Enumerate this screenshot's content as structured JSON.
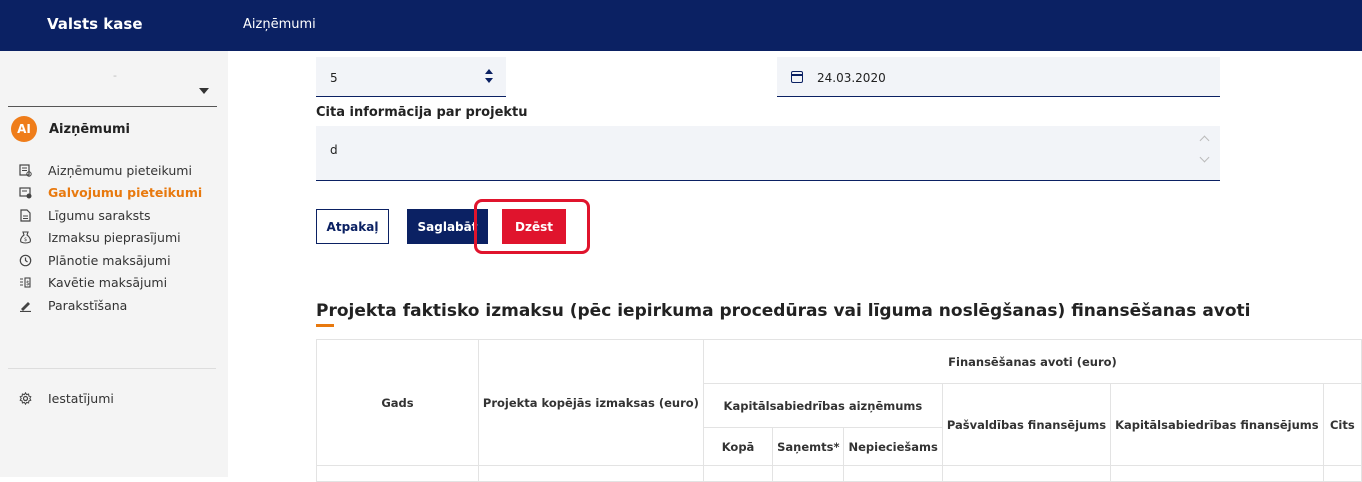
{
  "header": {
    "brand": "Valsts kase",
    "breadcrumb": "Aizņēmumi"
  },
  "sidebar": {
    "select_value": "-",
    "module": {
      "avatar": "AI",
      "title": "Aizņēmumi"
    },
    "items": [
      {
        "label": "Aizņēmumu pieteikumi",
        "icon": "application-icon"
      },
      {
        "label": "Galvojumu pieteikumi",
        "icon": "guarantee-icon",
        "active": true
      },
      {
        "label": "Līgumu saraksts",
        "icon": "document-icon"
      },
      {
        "label": "Izmaksu pieprasījumi",
        "icon": "money-bag-icon"
      },
      {
        "label": "Plānotie maksājumi",
        "icon": "clock-icon"
      },
      {
        "label": "Kavētie maksājumi",
        "icon": "overdue-icon"
      },
      {
        "label": "Parakstīšana",
        "icon": "sign-icon"
      }
    ],
    "settings": {
      "label": "Iestatījumi",
      "icon": "gear-icon"
    }
  },
  "form": {
    "number_value": "5",
    "date_value": "24.03.2020",
    "other_info_label": "Cita informācija par projektu",
    "other_info_value": "d"
  },
  "buttons": {
    "back": "Atpakaļ",
    "save": "Saglabāt",
    "delete": "Dzēst"
  },
  "section": {
    "title": "Projekta faktisko izmaksu (pēc iepirkuma procedūras vai līguma noslēgšanas) finansēšanas avoti"
  },
  "table": {
    "col_year": "Gads",
    "col_total_cost": "Projekta kopējās izmaksas (euro)",
    "group_sources": "Finansēšanas avoti (euro)",
    "group_loan": "Kapitālsabiedrības aizņēmums",
    "col_loan_total": "Kopā",
    "col_loan_received": "Saņemts*",
    "col_loan_needed": "Nepieciešams",
    "col_municipal": "Pašvaldības finansējums",
    "col_company": "Kapitālsabiedrības finansējums",
    "col_other": "Cits"
  },
  "colors": {
    "navy": "#0b2163",
    "orange": "#e8790e",
    "red": "#e0142d"
  }
}
